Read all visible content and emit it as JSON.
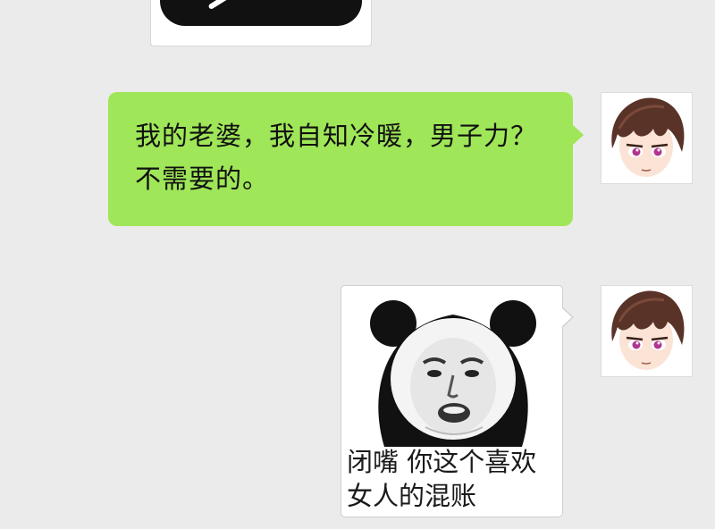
{
  "messages": [
    {
      "type": "image",
      "direction": "incoming",
      "partially_visible": true
    },
    {
      "type": "text",
      "direction": "outgoing",
      "text": "我的老婆，我自知冷暖，男子力？不需要的。",
      "bubble_color": "#9fe658"
    },
    {
      "type": "sticker",
      "direction": "outgoing",
      "sticker_icon": "panda-meme-face",
      "caption": "闭嘴 你这个喜欢\n女人的混账"
    }
  ],
  "colors": {
    "background": "#ebebeb",
    "outgoing_bubble": "#9fe658",
    "image_bubble_border": "#cfcfcf"
  },
  "avatar_icon": "anime-boy-avatar"
}
